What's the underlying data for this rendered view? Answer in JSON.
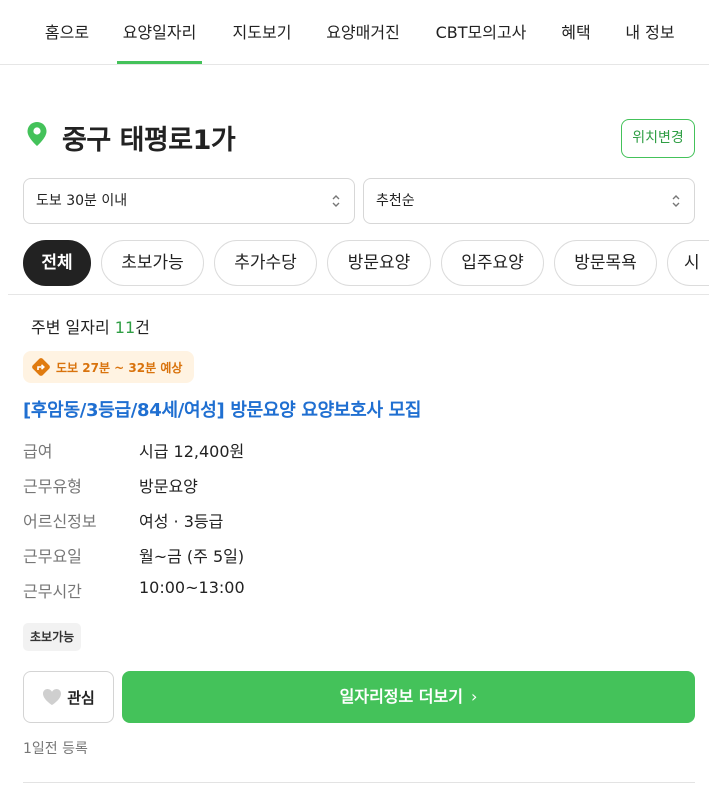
{
  "nav": {
    "items": [
      "홈으로",
      "요양일자리",
      "지도보기",
      "요양매거진",
      "CBT모의고사",
      "혜택",
      "내 정보"
    ],
    "active_index": 1
  },
  "location": {
    "title": "중구 태평로1가",
    "change_label": "위치변경"
  },
  "filters": {
    "distance": "도보 30분 이내",
    "sort": "추천순"
  },
  "chips": [
    "전체",
    "초보가능",
    "추가수당",
    "방문요양",
    "입주요양",
    "방문목욕",
    "시"
  ],
  "count": {
    "prefix": "주변 일자리 ",
    "number": "11",
    "suffix": "건"
  },
  "job": {
    "walk_label": "도보 27분 ~ 32분 예상",
    "title": "[후암동/3등급/84세/여성] 방문요양 요양보호사 모집",
    "details": [
      {
        "label": "급여",
        "value": "시급 12,400원"
      },
      {
        "label": "근무유형",
        "value": "방문요양"
      },
      {
        "label": "어르신정보",
        "value": "여성 · 3등급"
      },
      {
        "label": "근무요일",
        "value": "월~금 (주 5일)"
      },
      {
        "label": "근무시간",
        "value": "10:00~13:00"
      }
    ],
    "tag": "초보가능",
    "like_label": "관심",
    "more_label": "일자리정보 더보기",
    "posted": "1일전 등록"
  },
  "colors": {
    "accent": "#44c25a",
    "link": "#1f6fd1",
    "walk_badge": "#d9730d"
  },
  "icons": {
    "location": "map-pin-icon",
    "walk": "direction-icon",
    "like": "heart-icon",
    "select": "updown-chevron-icon",
    "more": "chevron-right-icon"
  }
}
